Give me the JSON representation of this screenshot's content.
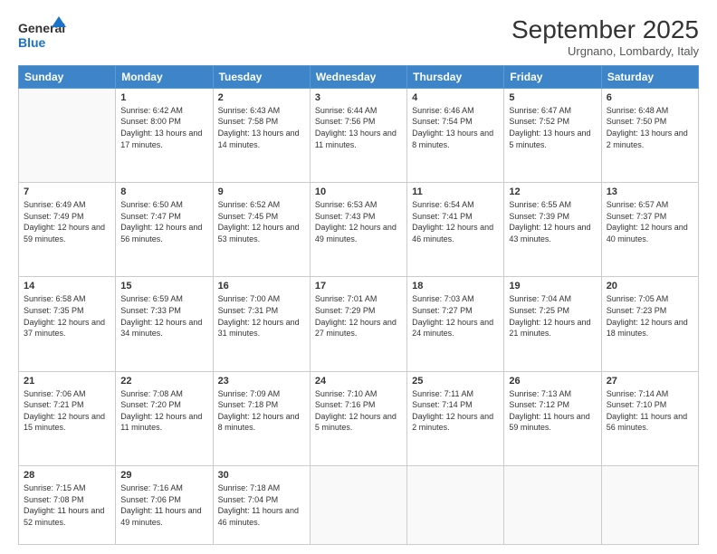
{
  "header": {
    "logo_general": "General",
    "logo_blue": "Blue",
    "month_title": "September 2025",
    "location": "Urgnano, Lombardy, Italy"
  },
  "days_of_week": [
    "Sunday",
    "Monday",
    "Tuesday",
    "Wednesday",
    "Thursday",
    "Friday",
    "Saturday"
  ],
  "weeks": [
    [
      {
        "num": "",
        "empty": true
      },
      {
        "num": "1",
        "sunrise": "6:42 AM",
        "sunset": "8:00 PM",
        "daylight": "13 hours and 17 minutes."
      },
      {
        "num": "2",
        "sunrise": "6:43 AM",
        "sunset": "7:58 PM",
        "daylight": "13 hours and 14 minutes."
      },
      {
        "num": "3",
        "sunrise": "6:44 AM",
        "sunset": "7:56 PM",
        "daylight": "13 hours and 11 minutes."
      },
      {
        "num": "4",
        "sunrise": "6:46 AM",
        "sunset": "7:54 PM",
        "daylight": "13 hours and 8 minutes."
      },
      {
        "num": "5",
        "sunrise": "6:47 AM",
        "sunset": "7:52 PM",
        "daylight": "13 hours and 5 minutes."
      },
      {
        "num": "6",
        "sunrise": "6:48 AM",
        "sunset": "7:50 PM",
        "daylight": "13 hours and 2 minutes."
      }
    ],
    [
      {
        "num": "7",
        "sunrise": "6:49 AM",
        "sunset": "7:49 PM",
        "daylight": "12 hours and 59 minutes."
      },
      {
        "num": "8",
        "sunrise": "6:50 AM",
        "sunset": "7:47 PM",
        "daylight": "12 hours and 56 minutes."
      },
      {
        "num": "9",
        "sunrise": "6:52 AM",
        "sunset": "7:45 PM",
        "daylight": "12 hours and 53 minutes."
      },
      {
        "num": "10",
        "sunrise": "6:53 AM",
        "sunset": "7:43 PM",
        "daylight": "12 hours and 49 minutes."
      },
      {
        "num": "11",
        "sunrise": "6:54 AM",
        "sunset": "7:41 PM",
        "daylight": "12 hours and 46 minutes."
      },
      {
        "num": "12",
        "sunrise": "6:55 AM",
        "sunset": "7:39 PM",
        "daylight": "12 hours and 43 minutes."
      },
      {
        "num": "13",
        "sunrise": "6:57 AM",
        "sunset": "7:37 PM",
        "daylight": "12 hours and 40 minutes."
      }
    ],
    [
      {
        "num": "14",
        "sunrise": "6:58 AM",
        "sunset": "7:35 PM",
        "daylight": "12 hours and 37 minutes."
      },
      {
        "num": "15",
        "sunrise": "6:59 AM",
        "sunset": "7:33 PM",
        "daylight": "12 hours and 34 minutes."
      },
      {
        "num": "16",
        "sunrise": "7:00 AM",
        "sunset": "7:31 PM",
        "daylight": "12 hours and 31 minutes."
      },
      {
        "num": "17",
        "sunrise": "7:01 AM",
        "sunset": "7:29 PM",
        "daylight": "12 hours and 27 minutes."
      },
      {
        "num": "18",
        "sunrise": "7:03 AM",
        "sunset": "7:27 PM",
        "daylight": "12 hours and 24 minutes."
      },
      {
        "num": "19",
        "sunrise": "7:04 AM",
        "sunset": "7:25 PM",
        "daylight": "12 hours and 21 minutes."
      },
      {
        "num": "20",
        "sunrise": "7:05 AM",
        "sunset": "7:23 PM",
        "daylight": "12 hours and 18 minutes."
      }
    ],
    [
      {
        "num": "21",
        "sunrise": "7:06 AM",
        "sunset": "7:21 PM",
        "daylight": "12 hours and 15 minutes."
      },
      {
        "num": "22",
        "sunrise": "7:08 AM",
        "sunset": "7:20 PM",
        "daylight": "12 hours and 11 minutes."
      },
      {
        "num": "23",
        "sunrise": "7:09 AM",
        "sunset": "7:18 PM",
        "daylight": "12 hours and 8 minutes."
      },
      {
        "num": "24",
        "sunrise": "7:10 AM",
        "sunset": "7:16 PM",
        "daylight": "12 hours and 5 minutes."
      },
      {
        "num": "25",
        "sunrise": "7:11 AM",
        "sunset": "7:14 PM",
        "daylight": "12 hours and 2 minutes."
      },
      {
        "num": "26",
        "sunrise": "7:13 AM",
        "sunset": "7:12 PM",
        "daylight": "11 hours and 59 minutes."
      },
      {
        "num": "27",
        "sunrise": "7:14 AM",
        "sunset": "7:10 PM",
        "daylight": "11 hours and 56 minutes."
      }
    ],
    [
      {
        "num": "28",
        "sunrise": "7:15 AM",
        "sunset": "7:08 PM",
        "daylight": "11 hours and 52 minutes."
      },
      {
        "num": "29",
        "sunrise": "7:16 AM",
        "sunset": "7:06 PM",
        "daylight": "11 hours and 49 minutes."
      },
      {
        "num": "30",
        "sunrise": "7:18 AM",
        "sunset": "7:04 PM",
        "daylight": "11 hours and 46 minutes."
      },
      {
        "num": "",
        "empty": true
      },
      {
        "num": "",
        "empty": true
      },
      {
        "num": "",
        "empty": true
      },
      {
        "num": "",
        "empty": true
      }
    ]
  ],
  "labels": {
    "sunrise": "Sunrise:",
    "sunset": "Sunset:",
    "daylight": "Daylight:"
  }
}
